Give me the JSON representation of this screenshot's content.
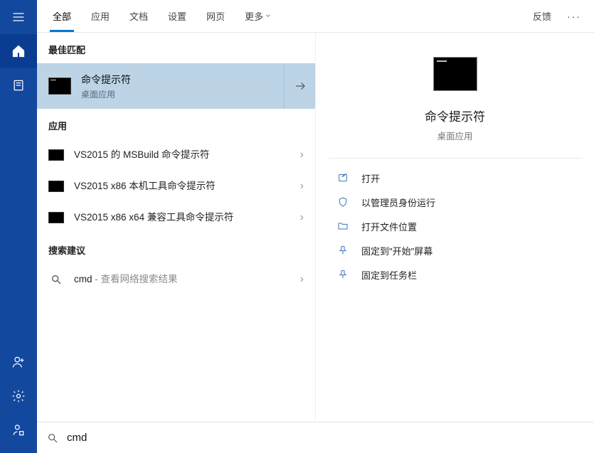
{
  "sidebar": {
    "items": [
      "menu",
      "home",
      "notebook"
    ],
    "bottom": [
      "person",
      "gear",
      "account"
    ]
  },
  "tabs": {
    "items": [
      "全部",
      "应用",
      "文档",
      "设置",
      "网页"
    ],
    "more": "更多",
    "feedback": "反馈"
  },
  "sections": {
    "best_match": "最佳匹配",
    "apps": "应用",
    "suggestions": "搜索建议"
  },
  "best_match": {
    "title": "命令提示符",
    "subtitle": "桌面应用"
  },
  "app_results": [
    "VS2015 的 MSBuild 命令提示符",
    "VS2015 x86 本机工具命令提示符",
    "VS2015 x86 x64 兼容工具命令提示符"
  ],
  "suggestion": {
    "term": "cmd",
    "hint": " - 查看网络搜索结果"
  },
  "details": {
    "title": "命令提示符",
    "subtitle": "桌面应用",
    "actions": [
      "打开",
      "以管理员身份运行",
      "打开文件位置",
      "固定到\"开始\"屏幕",
      "固定到任务栏"
    ]
  },
  "search": {
    "value": "cmd"
  }
}
